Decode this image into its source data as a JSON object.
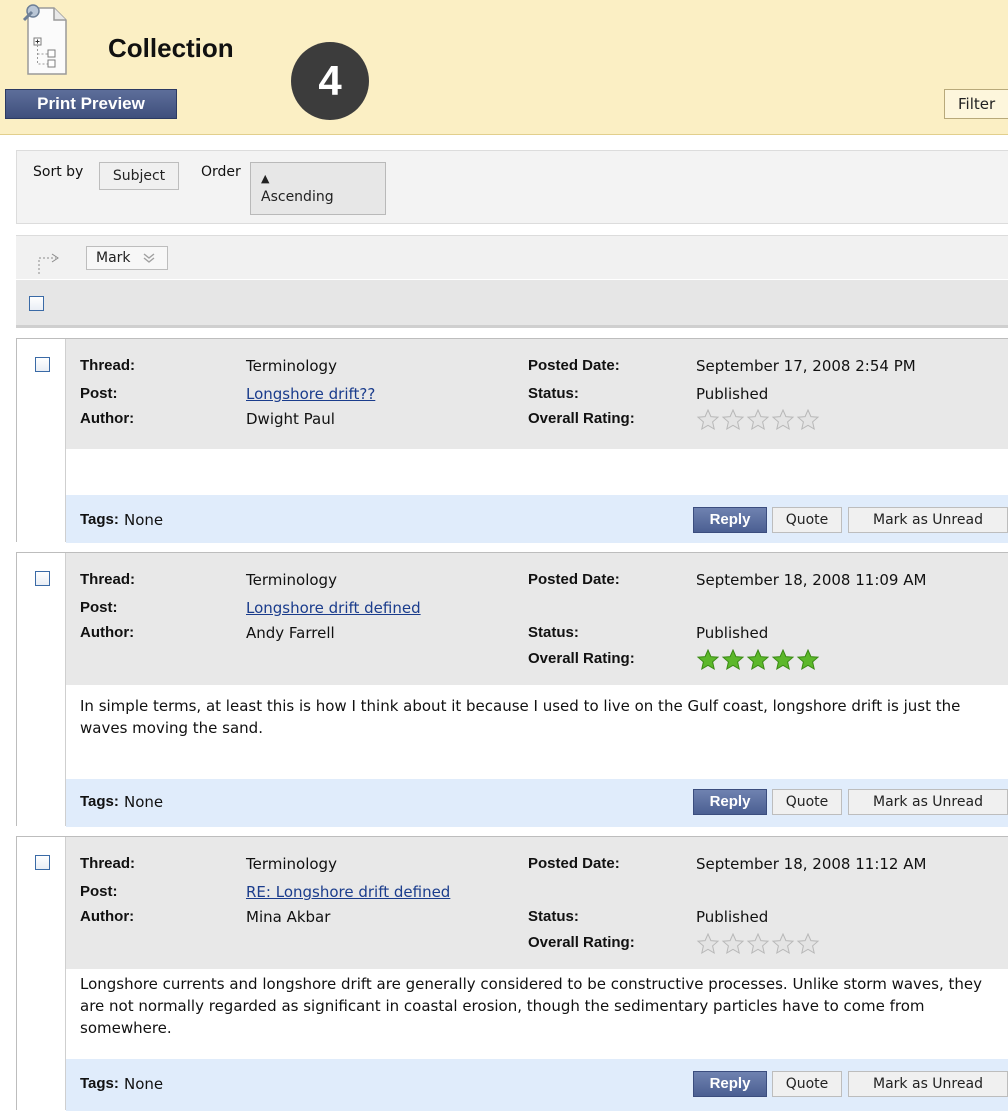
{
  "header": {
    "title": "Collection",
    "step_badge": "4",
    "print_preview_label": "Print Preview",
    "filter_label": "Filter"
  },
  "sort_bar": {
    "sort_by_label": "Sort by",
    "sort_value": "Subject",
    "order_label": "Order",
    "order_value": "Ascending"
  },
  "mark_bar": {
    "mark_label": "Mark"
  },
  "labels": {
    "thread": "Thread:",
    "post": "Post:",
    "author": "Author:",
    "posted_date": "Posted Date:",
    "status": "Status:",
    "overall_rating": "Overall Rating:",
    "tags": "Tags:",
    "reply": "Reply",
    "quote": "Quote",
    "mark_as_unread": "Mark as Unread"
  },
  "posts": [
    {
      "thread": "Terminology",
      "post": "Longshore drift??",
      "author": "Dwight Paul",
      "posted_date": "September 17, 2008 2:54 PM",
      "status": "Published",
      "rating": 0,
      "body": "",
      "tags": "None"
    },
    {
      "thread": "Terminology",
      "post": "Longshore drift defined",
      "author": "Andy Farrell",
      "posted_date": "September 18, 2008 11:09 AM",
      "status": "Published",
      "rating": 5,
      "body": "In simple terms, at least this is how I think about it because I used to live on the Gulf coast, longshore drift is just the waves moving the sand.",
      "tags": "None"
    },
    {
      "thread": "Terminology",
      "post": "RE: Longshore drift defined",
      "author": "Mina Akbar",
      "posted_date": "September 18, 2008 11:12 AM",
      "status": "Published",
      "rating": 0,
      "body": "Longshore currents and longshore drift are generally considered to be constructive processes. Unlike storm waves, they are not normally regarded as significant in coastal erosion, though the sedimentary particles have to come from somewhere.",
      "tags": "None"
    }
  ],
  "colors": {
    "header_bg": "#fbefc4",
    "star_filled": "#5cb82a",
    "star_empty": "#e4e4e4",
    "link": "#1a3c8c",
    "reply_button": "#4b5f92"
  }
}
